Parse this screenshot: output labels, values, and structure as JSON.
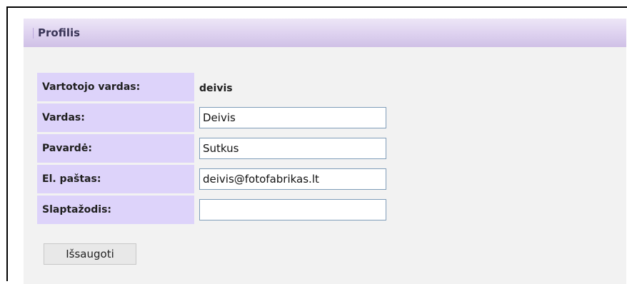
{
  "panel": {
    "title": "Profilis"
  },
  "form": {
    "username_label": "Vartotojo vardas:",
    "username_value": "deivis",
    "first_name_label": "Vardas:",
    "first_name_value": "Deivis",
    "last_name_label": "Pavardė:",
    "last_name_value": "Sutkus",
    "email_label": "El. paštas:",
    "email_value": "deivis@fotofabrikas.lt",
    "password_label": "Slaptažodis:",
    "password_value": ""
  },
  "actions": {
    "save_label": "Išsaugoti"
  },
  "colors": {
    "header_gradient_top": "#ede6f7",
    "header_gradient_bottom": "#cfc0e6",
    "label_background": "#ddd3fa",
    "panel_background": "#f2f2f2",
    "input_border": "#7f9db9"
  }
}
